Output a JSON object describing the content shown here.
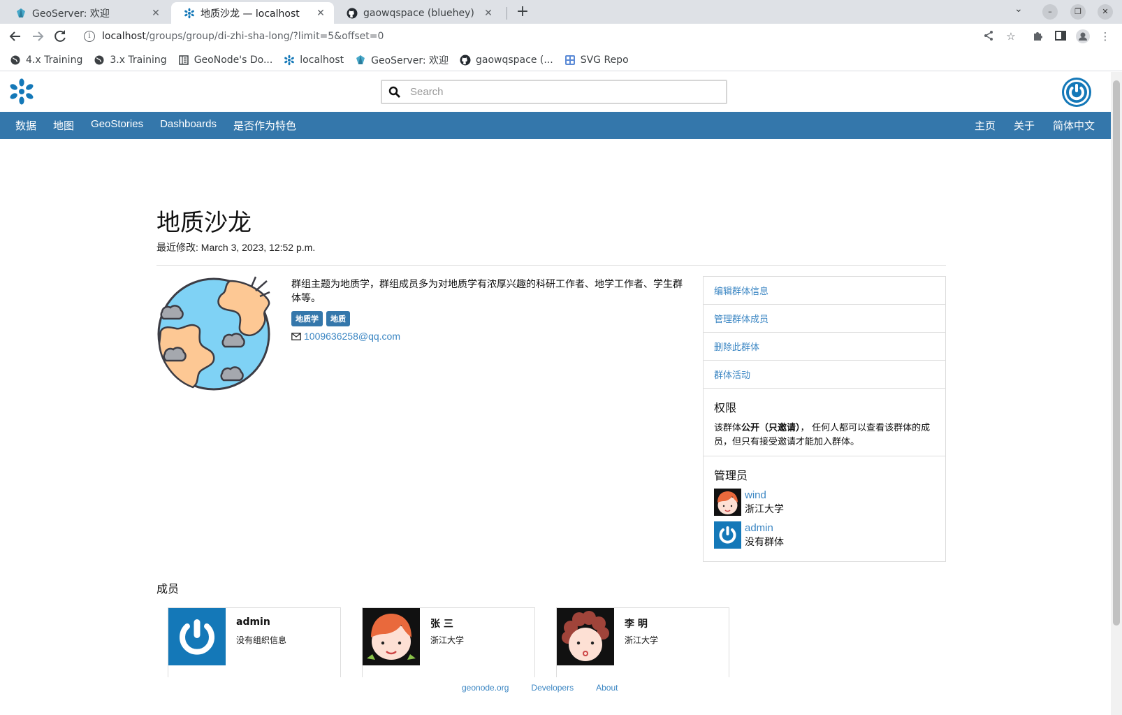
{
  "browser": {
    "tabs": [
      {
        "title": "GeoServer: 欢迎",
        "active": false
      },
      {
        "title": "地质沙龙 — localhost",
        "active": true
      },
      {
        "title": "gaowqspace (bluehey)",
        "active": false
      }
    ],
    "url": {
      "host": "localhost",
      "path": "/groups/group/di-zhi-sha-long/?limit=5&offset=0"
    },
    "bookmarks": [
      "4.x Training",
      "3.x Training",
      "GeoNode's Do...",
      "localhost",
      "GeoServer: 欢迎",
      "gaowqspace (...",
      "SVG Repo"
    ]
  },
  "header": {
    "search_placeholder": "Search",
    "nav_left": [
      "数据",
      "地图",
      "GeoStories",
      "Dashboards",
      "是否作为特色"
    ],
    "nav_right": [
      "主页",
      "关于",
      "简体中文"
    ]
  },
  "group": {
    "title": "地质沙龙",
    "modified": "最近修改: March 3, 2023, 12:52 p.m.",
    "description": "群组主题为地质学，群组成员多为对地质学有浓厚兴趣的科研工作者、地学工作者、学生群体等。",
    "tags": [
      "地质学",
      "地质"
    ],
    "email": "1009636258@qq.com"
  },
  "sidebar": {
    "links": [
      "编辑群体信息",
      "管理群体成员",
      "删除此群体",
      "群体活动"
    ],
    "permissions_title": "权限",
    "permissions_text_prefix": "该群体",
    "permissions_text_bold": "公开（只邀请）",
    "permissions_text_suffix": "， 任何人都可以查看该群体的成员，但只有接受邀请才能加入群体。",
    "managers_title": "管理员",
    "managers": [
      {
        "name": "wind",
        "org": "浙江大学",
        "avatar": "girl-avatar"
      },
      {
        "name": "admin",
        "org": "没有群体",
        "avatar": "power-avatar"
      }
    ]
  },
  "members": {
    "title": "成员",
    "cards": [
      {
        "name": "admin",
        "org": "没有组织信息",
        "avatar": "power-avatar"
      },
      {
        "name": "张 三",
        "org": "浙江大学",
        "avatar": "girl-avatar"
      },
      {
        "name": "李 明",
        "org": "浙江大学",
        "avatar": "curly-avatar"
      }
    ]
  },
  "footer": {
    "links": [
      "geonode.org",
      "Developers",
      "About"
    ]
  },
  "colors": {
    "nav": "#3477ab",
    "link": "#3b86c3",
    "accent": "#1478b8"
  }
}
